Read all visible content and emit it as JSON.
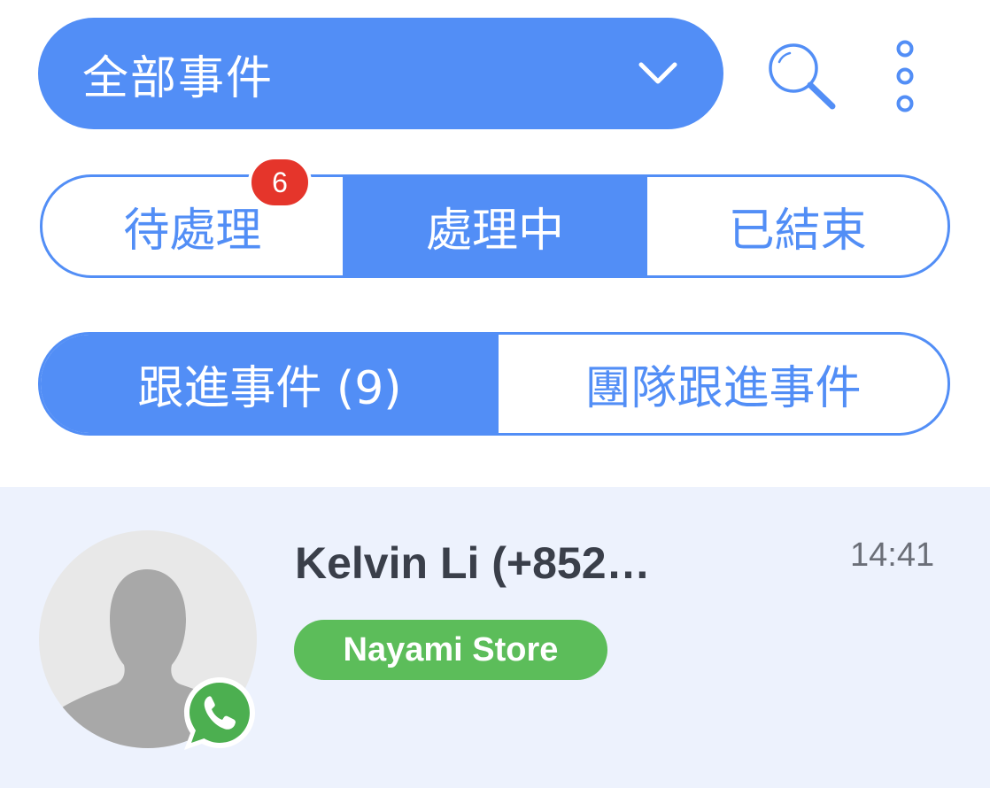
{
  "filter": {
    "selected": "全部事件",
    "icon": "chevron-down-icon"
  },
  "toolbar": {
    "search_icon": "search-icon",
    "more_icon": "more-vertical-icon"
  },
  "status_tabs": [
    {
      "label": "待處理",
      "active": false,
      "badge": "6"
    },
    {
      "label": "處理中",
      "active": true
    },
    {
      "label": "已結束",
      "active": false
    }
  ],
  "scope_tabs": [
    {
      "label": "跟進事件 (9)",
      "active": true
    },
    {
      "label": "團隊跟進事件",
      "active": false
    }
  ],
  "conversations": [
    {
      "name": "Kelvin Li (+852…",
      "time": "14:41",
      "tag": "Nayami Store",
      "channel_icon": "whatsapp-icon",
      "avatar": "avatar-placeholder"
    }
  ],
  "colors": {
    "accent": "#528ef6",
    "badge": "#e5352b",
    "tag": "#5cbd5a",
    "whatsapp": "#4caf50",
    "row_bg": "#edf2fd"
  }
}
